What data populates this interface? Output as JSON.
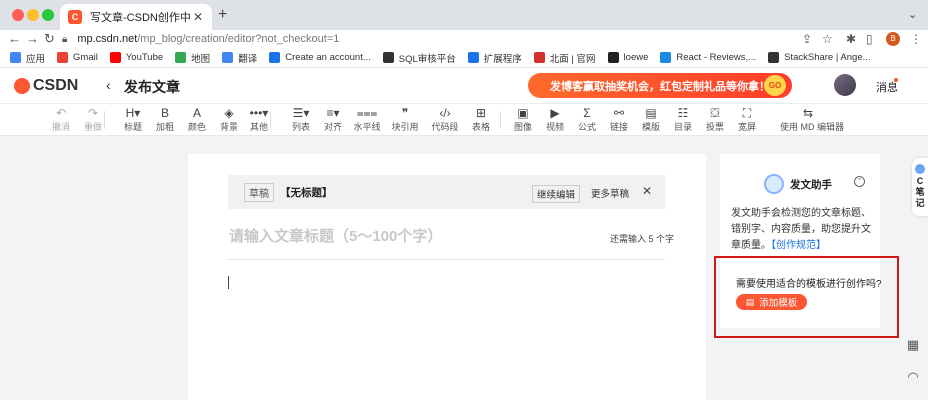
{
  "browser": {
    "tab_title": "写文章-CSDN创作中心",
    "tab_favicon": "C",
    "new_tab_icon": "+",
    "url_host": "mp.csdn.net",
    "url_path": "/mp_blog/creation/editor?not_checkout=1",
    "profile_initial": "B",
    "bookmarks": [
      {
        "label": "应用",
        "icon": "apps-grid-icon",
        "color": "#4285f4"
      },
      {
        "label": "Gmail",
        "icon": "gmail-icon",
        "color": "#ea4335"
      },
      {
        "label": "YouTube",
        "icon": "youtube-icon",
        "color": "#ff0000"
      },
      {
        "label": "地图",
        "icon": "maps-icon",
        "color": "#34a853"
      },
      {
        "label": "翻译",
        "icon": "translate-icon",
        "color": "#4285f4"
      },
      {
        "label": "Create an account...",
        "icon": "account-icon",
        "color": "#1a73e8"
      },
      {
        "label": "SQL审核平台",
        "icon": "sql-icon",
        "color": "#333333"
      },
      {
        "label": "扩展程序",
        "icon": "extension-icon",
        "color": "#1a73e8"
      },
      {
        "label": "北面 | 官网",
        "icon": "northface-icon",
        "color": "#d32f2f"
      },
      {
        "label": "loewe",
        "icon": "loewe-icon",
        "color": "#222222"
      },
      {
        "label": "React - Reviews,...",
        "icon": "react-icon",
        "color": "#1e88e5"
      },
      {
        "label": "StackShare | Ange...",
        "icon": "stackshare-icon",
        "color": "#333333"
      }
    ]
  },
  "header": {
    "logo_text": "CSDN",
    "back_icon": "‹",
    "title": "发布文章",
    "title_caret": "▾",
    "banner_text": "发博客赢取抽奖机会，红包定制礼品等你拿！",
    "banner_go": "GO",
    "messages_label": "消息"
  },
  "toolbar": {
    "tools": [
      {
        "key": "undo",
        "icon": "↶",
        "label": "撤消",
        "disabled": true
      },
      {
        "key": "redo",
        "icon": "↷",
        "label": "重做",
        "disabled": true
      },
      {
        "key": "heading",
        "icon": "H▾",
        "label": "标题"
      },
      {
        "key": "bold",
        "icon": "B",
        "label": "加粗"
      },
      {
        "key": "color",
        "icon": "A",
        "label": "颜色"
      },
      {
        "key": "background",
        "icon": "◈",
        "label": "背景"
      },
      {
        "key": "other",
        "icon": "•••▾",
        "label": "其他"
      },
      {
        "key": "list",
        "icon": "☰▾",
        "label": "列表"
      },
      {
        "key": "align",
        "icon": "≡▾",
        "label": "对齐"
      },
      {
        "key": "hr",
        "icon": "⩶",
        "label": "水平线"
      },
      {
        "key": "quote",
        "icon": "❞",
        "label": "块引用"
      },
      {
        "key": "code",
        "icon": "‹/›",
        "label": "代码段"
      },
      {
        "key": "table",
        "icon": "⊞",
        "label": "表格"
      },
      {
        "key": "image",
        "icon": "▣",
        "label": "图像"
      },
      {
        "key": "video",
        "icon": "▶",
        "label": "视频"
      },
      {
        "key": "formula",
        "icon": "Σ",
        "label": "公式"
      },
      {
        "key": "link",
        "icon": "⚯",
        "label": "链接"
      },
      {
        "key": "template",
        "icon": "▤",
        "label": "模版"
      },
      {
        "key": "toc",
        "icon": "☷",
        "label": "目录"
      },
      {
        "key": "vote",
        "icon": "⛋",
        "label": "投票"
      },
      {
        "key": "widescreen",
        "icon": "⛶",
        "label": "宽屏"
      },
      {
        "key": "md",
        "icon": "⇆",
        "label": "使用 MD 编辑器"
      }
    ]
  },
  "editor": {
    "draft_badge": "草稿",
    "draft_title": "【无标题】",
    "continue_edit": "继续编辑",
    "more_drafts": "更多草稿",
    "close_icon": "✕",
    "title_placeholder": "请输入文章标题（5～100个字）",
    "remaining": "还需输入 5 个字"
  },
  "assistant": {
    "name": "发文助手",
    "collapse_icon": "⌃",
    "description": "发文助手会检测您的文章标题、错别字、内容质量，助您提升文章质量。",
    "rules_link": "【创作规范】",
    "template_question": "需要使用适合的模板进行创作吗?",
    "template_button": "添加模板",
    "highlight_color": "#d01818"
  },
  "sidebar": {
    "tab_text": [
      "C",
      "笔",
      "记"
    ],
    "qr_icon": "▦",
    "support_icon": "◠"
  }
}
